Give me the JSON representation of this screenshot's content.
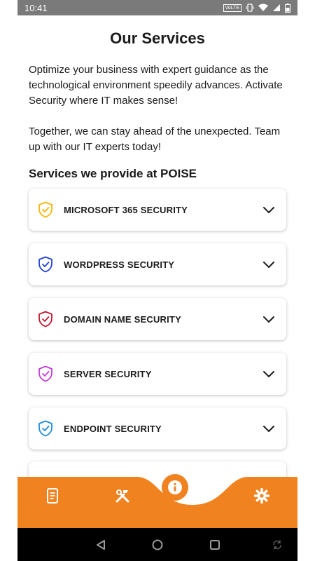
{
  "status_bar": {
    "time": "10:41",
    "volte": "VoLTE"
  },
  "page": {
    "title": "Our Services",
    "intro_1": "Optimize your business with expert guidance as the technological environment speedily advances. Activate Security where IT makes sense!",
    "intro_2": "Together, we can stay ahead of the unexpected. Team up with our IT experts today!",
    "section_heading": "Services we provide at POISE"
  },
  "services": [
    {
      "label": "MICROSOFT 365 SECURITY",
      "icon": "shield-check-icon",
      "color": "#f2b705"
    },
    {
      "label": "WORDPRESS SECURITY",
      "icon": "shield-check-icon",
      "color": "#1f3fd6"
    },
    {
      "label": "DOMAIN NAME SECURITY",
      "icon": "shield-check-icon",
      "color": "#c0182d"
    },
    {
      "label": "SERVER SECURITY",
      "icon": "shield-check-icon",
      "color": "#c53ad6"
    },
    {
      "label": "ENDPOINT SECURITY",
      "icon": "shield-check-icon",
      "color": "#1c8be0"
    }
  ],
  "bottom_nav": {
    "items": [
      {
        "icon": "document-icon"
      },
      {
        "icon": "tools-icon"
      },
      {
        "icon": "info-icon",
        "active": true
      },
      {
        "icon": "gear-icon"
      }
    ],
    "color": "#f08220"
  },
  "colors": {
    "accent": "#f08220",
    "text": "#1a1a1a"
  }
}
